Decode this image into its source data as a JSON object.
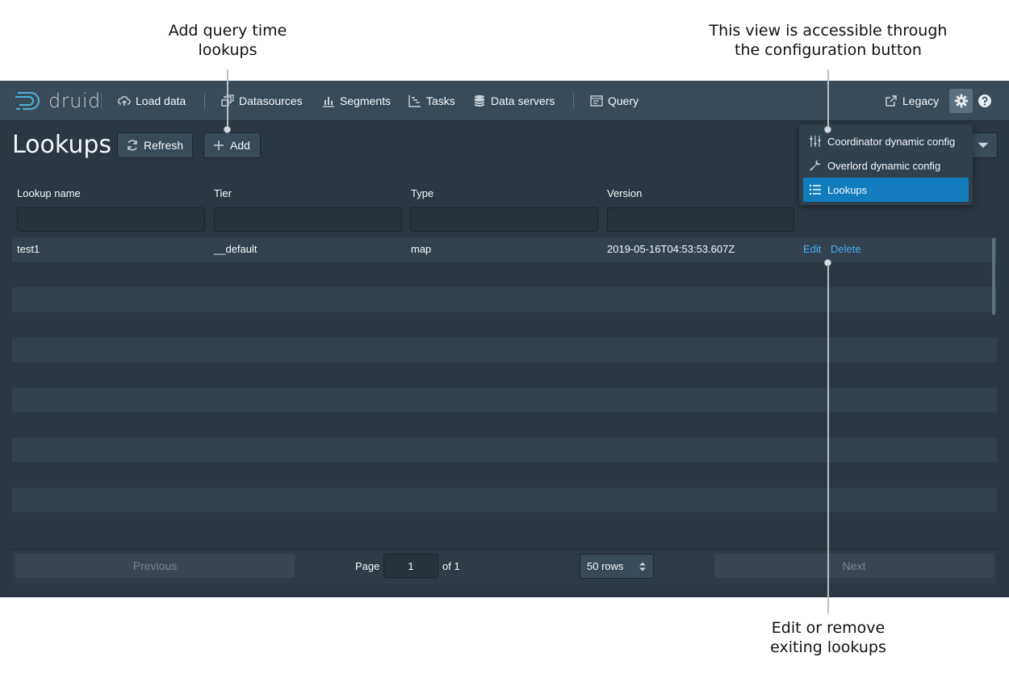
{
  "annotations": {
    "add": [
      "Add query time",
      "lookups"
    ],
    "config": [
      "This view is accessible through",
      "the configuration button"
    ],
    "edit": [
      "Edit or remove",
      "exiting lookups"
    ]
  },
  "nav": {
    "logo": "druid",
    "items": {
      "load_data": "Load data",
      "datasources": "Datasources",
      "segments": "Segments",
      "tasks": "Tasks",
      "data_servers": "Data servers",
      "query": "Query",
      "legacy": "Legacy"
    }
  },
  "page": {
    "title": "Lookups",
    "refresh": "Refresh",
    "add": "Add"
  },
  "table": {
    "columns": [
      "Lookup name",
      "Tier",
      "Type",
      "Version"
    ],
    "rows": [
      {
        "name": "test1",
        "tier": "__default",
        "type": "map",
        "version": "2019-05-16T04:53:53.607Z",
        "edit": "Edit",
        "delete": "Delete"
      }
    ]
  },
  "pagination": {
    "previous": "Previous",
    "page_label": "Page",
    "page_value": "1",
    "of_label": "of 1",
    "rows_label": "50 rows",
    "next": "Next"
  },
  "menu": {
    "items": [
      "Coordinator dynamic config",
      "Overlord dynamic config",
      "Lookups"
    ],
    "active": "Lookups"
  },
  "colors": {
    "navbar": "#394b59",
    "background": "#2b3742",
    "accent": "#137cbd",
    "link": "#48aff0"
  }
}
